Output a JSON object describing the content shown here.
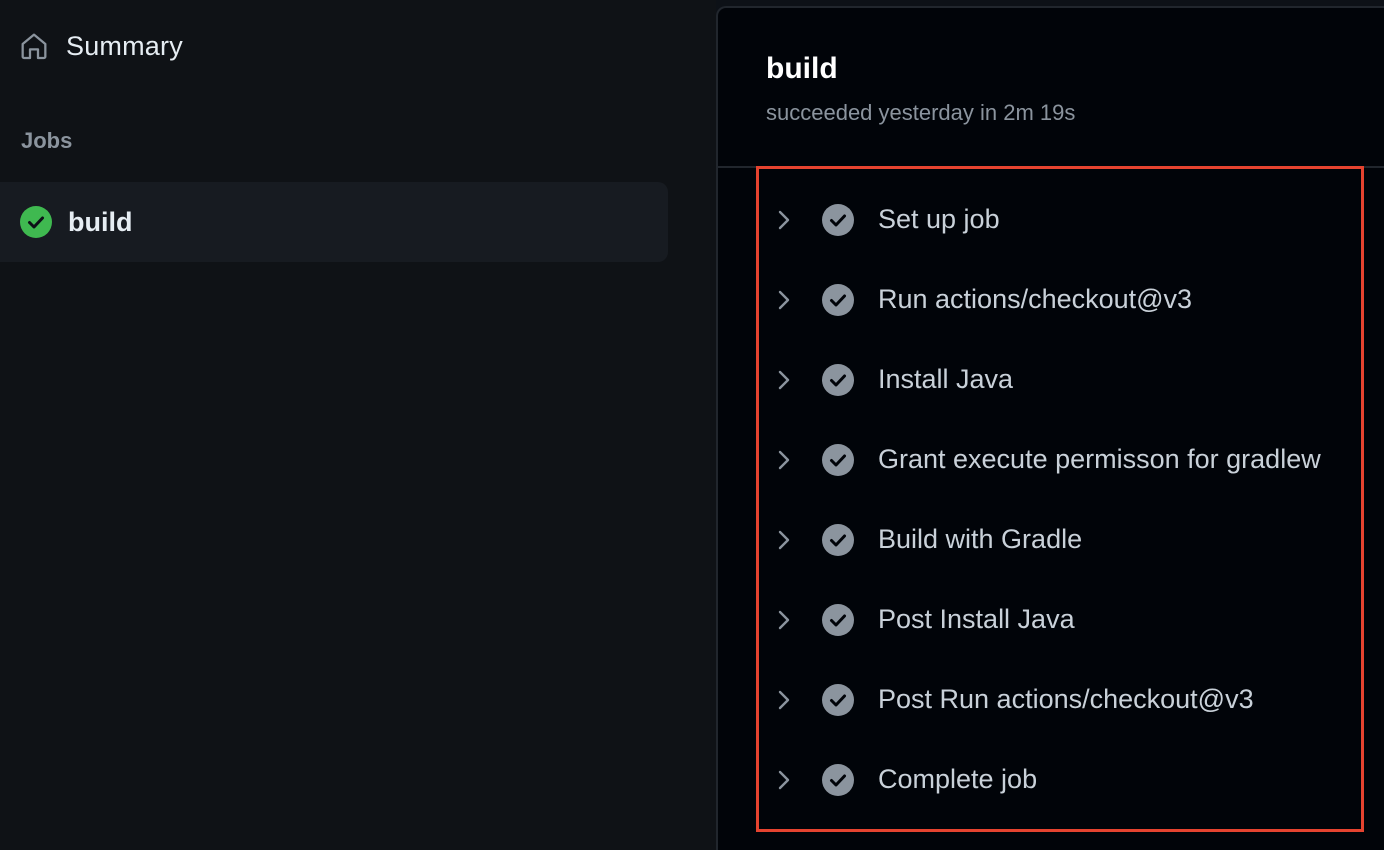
{
  "sidebar": {
    "summary_label": "Summary",
    "summary_icon": "home-icon",
    "jobs_heading": "Jobs",
    "jobs": [
      {
        "label": "build",
        "status": "success",
        "status_icon": "check-circle-fill-icon"
      }
    ]
  },
  "main": {
    "job_title": "build",
    "job_subtitle": "succeeded yesterday in 2m 19s",
    "steps": [
      {
        "label": "Set up job"
      },
      {
        "label": "Run actions/checkout@v3"
      },
      {
        "label": "Install Java"
      },
      {
        "label": "Grant execute permisson for gradlew"
      },
      {
        "label": "Build with Gradle"
      },
      {
        "label": "Post Install Java"
      },
      {
        "label": "Post Run actions/checkout@v3"
      },
      {
        "label": "Complete job"
      }
    ]
  },
  "colors": {
    "background": "#0d1117",
    "sidebar_background": "#0f1216",
    "panel_background": "#010409",
    "success_green": "#3fb950",
    "step_check_gray": "#8b949e",
    "highlight_red": "#e5432f",
    "muted_text": "#8b949e"
  }
}
